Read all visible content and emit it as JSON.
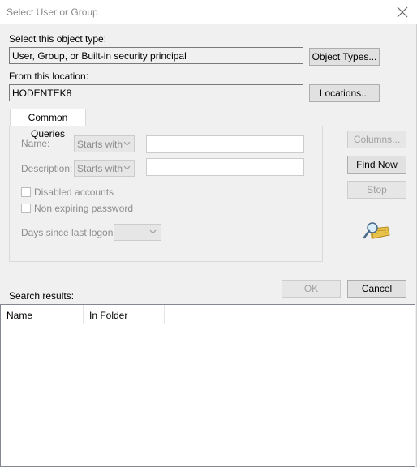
{
  "window": {
    "title": "Select User or Group"
  },
  "object_type": {
    "label": "Select this object type:",
    "value": "User, Group, or Built-in security principal",
    "button": "Object Types..."
  },
  "location": {
    "label": "From this location:",
    "value": "HODENTEK8",
    "button": "Locations..."
  },
  "queries": {
    "tab": "Common Queries",
    "name_label": "Name:",
    "name_mode": "Starts with",
    "description_label": "Description:",
    "description_mode": "Starts with",
    "disabled_accounts": "Disabled accounts",
    "non_expiring_password": "Non expiring password",
    "days_label": "Days since last logon:"
  },
  "side_buttons": {
    "columns": "Columns...",
    "find_now": "Find Now",
    "stop": "Stop"
  },
  "icons": {
    "search": "magnifier-over-folder-icon",
    "close": "close-icon",
    "dropdown": "chevron-down-icon"
  },
  "footer": {
    "ok": "OK",
    "cancel": "Cancel"
  },
  "results": {
    "label": "Search results:",
    "columns": [
      "Name",
      "In Folder"
    ]
  }
}
